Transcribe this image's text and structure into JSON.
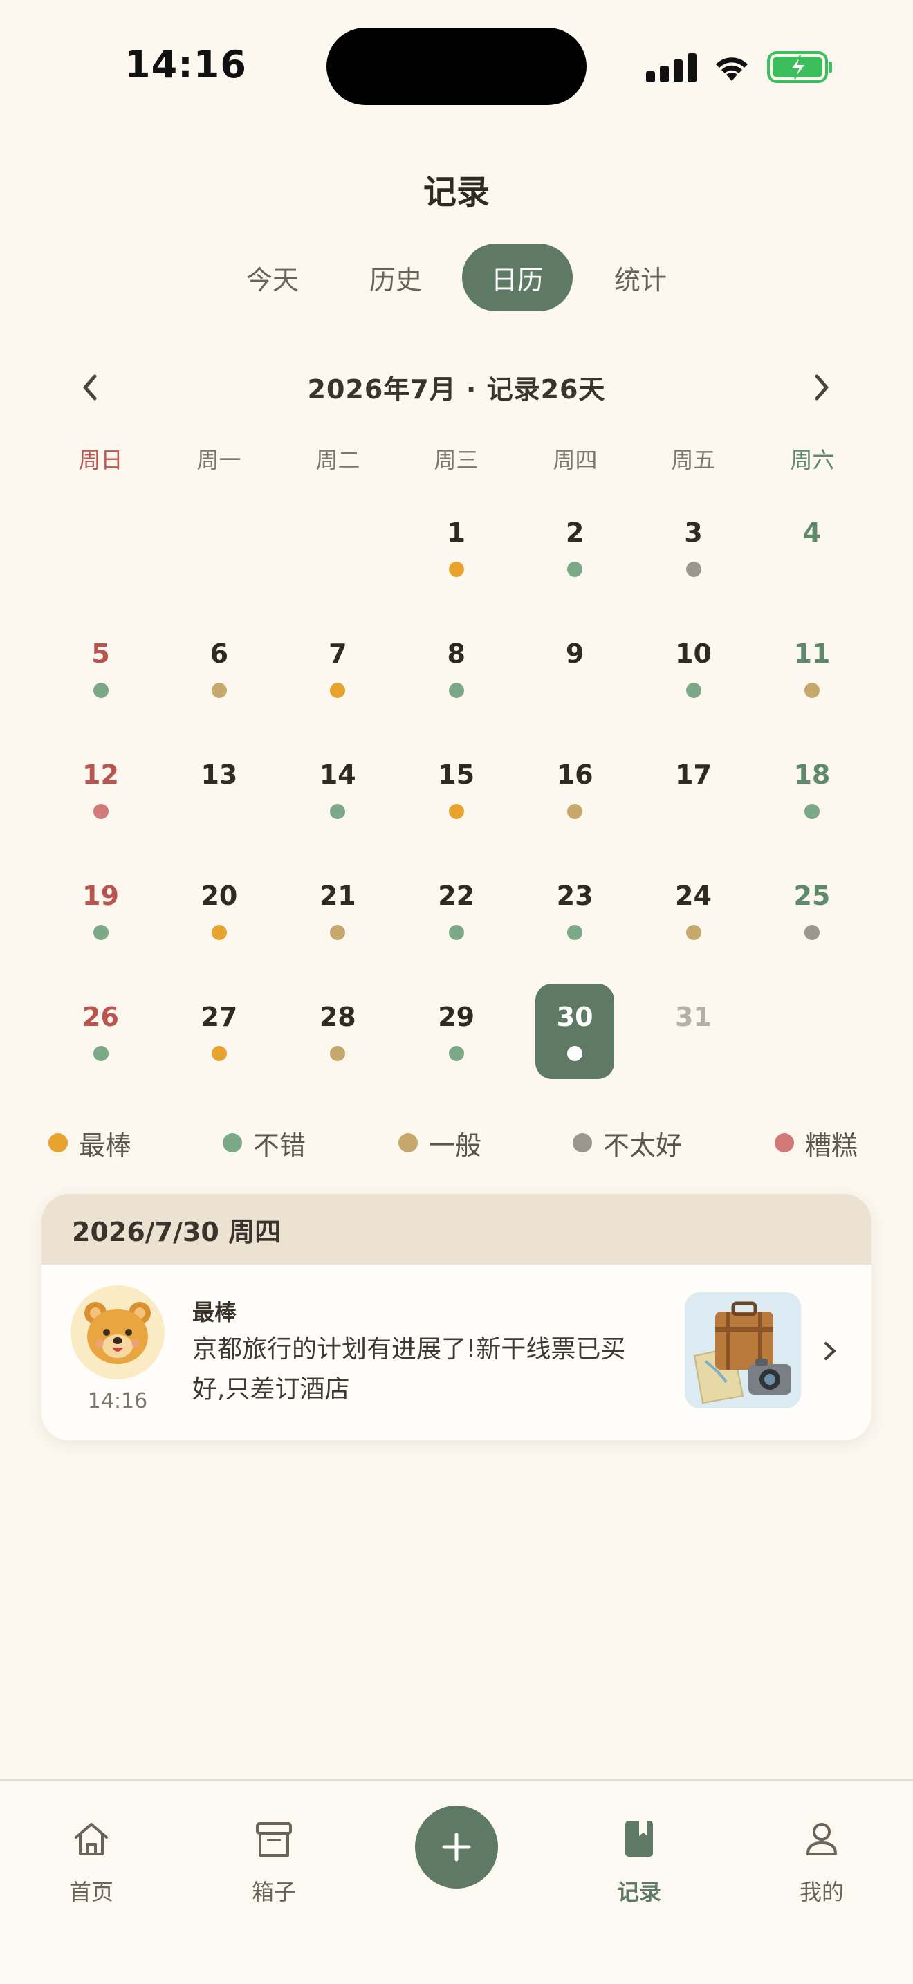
{
  "status_bar": {
    "time": "14:16"
  },
  "header": {
    "title": "记录"
  },
  "tabs": [
    {
      "label": "今天",
      "active": false
    },
    {
      "label": "历史",
      "active": false
    },
    {
      "label": "日历",
      "active": true
    },
    {
      "label": "统计",
      "active": false
    }
  ],
  "month_nav": {
    "title": "2026年7月 · 记录26天"
  },
  "weekdays": [
    "周日",
    "周一",
    "周二",
    "周三",
    "周四",
    "周五",
    "周六"
  ],
  "moods": {
    "best": {
      "label": "最棒",
      "color": "#E8A22E"
    },
    "good": {
      "label": "不错",
      "color": "#7BA987"
    },
    "okay": {
      "label": "一般",
      "color": "#C6A86C"
    },
    "meh": {
      "label": "不太好",
      "color": "#9B968D"
    },
    "bad": {
      "label": "糟糕",
      "color": "#D27A7A"
    }
  },
  "legend": [
    "best",
    "good",
    "okay",
    "meh",
    "bad"
  ],
  "calendar": {
    "first_weekday": 3,
    "selected": 30,
    "days": [
      {
        "day": "1",
        "mood": "best"
      },
      {
        "day": "2",
        "mood": "good"
      },
      {
        "day": "3",
        "mood": "meh"
      },
      {
        "day": "4",
        "mood": null
      },
      {
        "day": "5",
        "mood": "good"
      },
      {
        "day": "6",
        "mood": "okay"
      },
      {
        "day": "7",
        "mood": "best"
      },
      {
        "day": "8",
        "mood": "good"
      },
      {
        "day": "9",
        "mood": null
      },
      {
        "day": "10",
        "mood": "good"
      },
      {
        "day": "11",
        "mood": "okay"
      },
      {
        "day": "12",
        "mood": "bad"
      },
      {
        "day": "13",
        "mood": null
      },
      {
        "day": "14",
        "mood": "good"
      },
      {
        "day": "15",
        "mood": "best"
      },
      {
        "day": "16",
        "mood": "okay"
      },
      {
        "day": "17",
        "mood": null
      },
      {
        "day": "18",
        "mood": "good"
      },
      {
        "day": "19",
        "mood": "good"
      },
      {
        "day": "20",
        "mood": "best"
      },
      {
        "day": "21",
        "mood": "okay"
      },
      {
        "day": "22",
        "mood": "good"
      },
      {
        "day": "23",
        "mood": "good"
      },
      {
        "day": "24",
        "mood": "okay"
      },
      {
        "day": "25",
        "mood": "meh"
      },
      {
        "day": "26",
        "mood": "good"
      },
      {
        "day": "27",
        "mood": "best"
      },
      {
        "day": "28",
        "mood": "okay"
      },
      {
        "day": "29",
        "mood": "good"
      },
      {
        "day": "30",
        "mood": "selected"
      },
      {
        "day": "31",
        "mood": null,
        "future": true
      }
    ]
  },
  "day_card": {
    "date": "2026/7/30 周四",
    "entry": {
      "mood_label": "最棒",
      "time": "14:16",
      "text": "京都旅行的计划有进展了!新干线票已买好,只差订酒店",
      "avatar_icon": "bear-face-icon",
      "thumbnail_icon": "suitcase-map-camera-icon"
    }
  },
  "tabbar": {
    "items": [
      {
        "label": "首页",
        "icon": "home-icon",
        "active": false
      },
      {
        "label": "箱子",
        "icon": "archive-box-icon",
        "active": false
      },
      {
        "label": "记录",
        "icon": "bookmark-book-icon",
        "active": true
      },
      {
        "label": "我的",
        "icon": "person-icon",
        "active": false
      }
    ],
    "add_icon": "plus-icon"
  },
  "colors": {
    "accent": "#5E7A64",
    "background": "#FCF7EF",
    "card_header": "#ECE2D2"
  }
}
